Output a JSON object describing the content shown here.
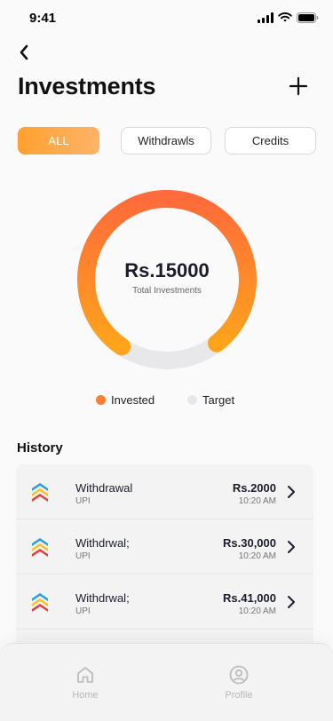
{
  "status_bar": {
    "time": "9:41"
  },
  "header": {
    "title": "Investments"
  },
  "filters": [
    {
      "label": "ALL",
      "active": true
    },
    {
      "label": "Withdrawls",
      "active": false
    },
    {
      "label": "Credits",
      "active": false
    }
  ],
  "summary": {
    "value": "Rs.15000",
    "label": "Total Investments",
    "invested_fraction": 0.8
  },
  "legend": [
    {
      "label": "Invested",
      "color": "#ff7d2e"
    },
    {
      "label": "Target",
      "color": "#e8e8ea"
    }
  ],
  "history": {
    "title": "History",
    "items": [
      {
        "title": "Withdrawal",
        "method": "UPI",
        "amount": "Rs.2000",
        "time": "10:20 AM"
      },
      {
        "title": "Withdrwal;",
        "method": "UPI",
        "amount": "Rs.30,000",
        "time": "10:20 AM"
      },
      {
        "title": "Withdrwal;",
        "method": "UPI",
        "amount": "Rs.41,000",
        "time": "10:20 AM"
      }
    ]
  },
  "nav": {
    "home_label": "Home",
    "profile_label": "Profile"
  },
  "colors": {
    "accent_orange": "#ff8c1a",
    "ring_start": "#ff6b3a",
    "ring_end": "#ffa41b",
    "ring_track": "#e8e8ea"
  },
  "icons": {
    "back": "chevron-left-icon",
    "add": "plus-icon",
    "history_item": "stacked-chevron-logo-icon",
    "row_chevron": "chevron-right-icon",
    "home": "home-icon",
    "profile": "user-circle-icon"
  }
}
